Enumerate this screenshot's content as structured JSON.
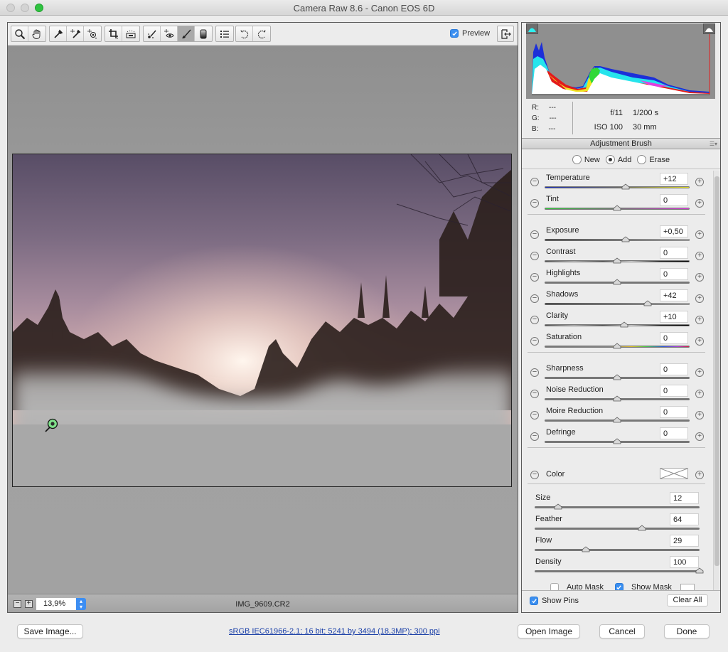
{
  "window": {
    "title": "Camera Raw 8.6  -  Canon EOS 6D"
  },
  "toolbar": {
    "tools": [
      {
        "name": "zoom-tool",
        "icon": "magnifier-icon"
      },
      {
        "name": "hand-tool",
        "icon": "hand-icon"
      },
      {
        "name": "white-balance-tool",
        "icon": "eyedropper-icon"
      },
      {
        "name": "color-sampler-tool",
        "icon": "color-sampler-icon"
      },
      {
        "name": "targeted-adjustment-tool",
        "icon": "target-adjust-icon"
      },
      {
        "name": "crop-tool",
        "icon": "crop-icon"
      },
      {
        "name": "straighten-tool",
        "icon": "level-icon"
      },
      {
        "name": "spot-removal-tool",
        "icon": "spot-brush-icon"
      },
      {
        "name": "red-eye-tool",
        "icon": "eye-icon"
      },
      {
        "name": "adjustment-brush-tool",
        "icon": "brush-icon",
        "active": true
      },
      {
        "name": "graduated-filter-tool",
        "icon": "gradient-icon"
      },
      {
        "name": "preferences",
        "icon": "list-icon"
      },
      {
        "name": "rotate-ccw",
        "icon": "rotate-left-icon"
      },
      {
        "name": "rotate-cw",
        "icon": "rotate-right-icon"
      }
    ],
    "preview_label": "Preview",
    "preview_checked": true
  },
  "canvas": {
    "zoom_level": "13,9%",
    "filename": "IMG_9609.CR2"
  },
  "histogram": {
    "r_label": "R:",
    "g_label": "G:",
    "b_label": "B:",
    "r_value": "---",
    "g_value": "---",
    "b_value": "---",
    "aperture": "f/11",
    "shutter": "1/200 s",
    "iso": "ISO 100",
    "focal_length": "30 mm"
  },
  "panel": {
    "title": "Adjustment Brush",
    "modes": [
      {
        "label": "New",
        "selected": false
      },
      {
        "label": "Add",
        "selected": true
      },
      {
        "label": "Erase",
        "selected": false
      }
    ],
    "sliders": [
      {
        "label": "Temperature",
        "value": "+12",
        "position": 0.56,
        "gradient": "temperature"
      },
      {
        "label": "Tint",
        "value": "0",
        "position": 0.5,
        "gradient": "tint"
      },
      {
        "label": "Exposure",
        "value": "+0,50",
        "position": 0.56,
        "gradient": "exposure"
      },
      {
        "label": "Contrast",
        "value": "0",
        "position": 0.5,
        "gradient": "contrast"
      },
      {
        "label": "Highlights",
        "value": "0",
        "position": 0.5,
        "gradient": "plain"
      },
      {
        "label": "Shadows",
        "value": "+42",
        "position": 0.71,
        "gradient": "exposure"
      },
      {
        "label": "Clarity",
        "value": "+10",
        "position": 0.55,
        "gradient": "contrast"
      },
      {
        "label": "Saturation",
        "value": "0",
        "position": 0.5,
        "gradient": "saturation"
      },
      {
        "label": "Sharpness",
        "value": "0",
        "position": 0.5,
        "gradient": "plain"
      },
      {
        "label": "Noise Reduction",
        "value": "0",
        "position": 0.5,
        "gradient": "plain"
      },
      {
        "label": "Moire Reduction",
        "value": "0",
        "position": 0.5,
        "gradient": "plain"
      },
      {
        "label": "Defringe",
        "value": "0",
        "position": 0.5,
        "gradient": "plain"
      }
    ],
    "color_label": "Color",
    "brush": [
      {
        "label": "Size",
        "value": "12",
        "position": 0.12
      },
      {
        "label": "Feather",
        "value": "64",
        "position": 0.64
      },
      {
        "label": "Flow",
        "value": "29",
        "position": 0.29
      },
      {
        "label": "Density",
        "value": "100",
        "position": 1.0
      }
    ],
    "auto_mask_label": "Auto Mask",
    "auto_mask_checked": false,
    "show_mask_label": "Show Mask",
    "show_mask_checked": true,
    "show_pins_label": "Show Pins",
    "show_pins_checked": true,
    "clear_all_label": "Clear All"
  },
  "footer": {
    "save_image_label": "Save Image...",
    "workflow_options": "sRGB IEC61966-2.1; 16 bit; 5241 by 3494 (18,3MP); 300 ppi",
    "open_image_label": "Open Image",
    "cancel_label": "Cancel",
    "done_label": "Done"
  },
  "colors": {
    "accent": "#3b8ff0",
    "link": "#1a3fa7",
    "pin": "#7fe08a"
  }
}
